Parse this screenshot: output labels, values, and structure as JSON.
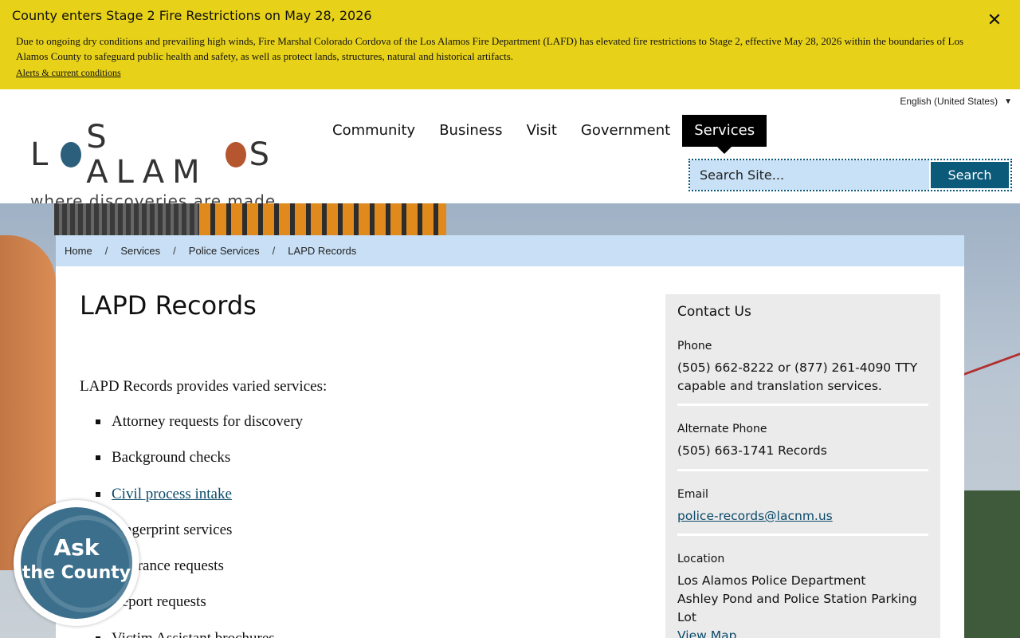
{
  "alert": {
    "title": "County enters Stage 2 Fire Restrictions on May 28, 2026",
    "body": "Due to ongoing dry conditions and prevailing high winds, Fire Marshal Colorado Cordova of the Los Alamos Fire Department (LAFD) has elevated fire restrictions to Stage 2, effective May 28, 2026 within the boundaries of Los Alamos County to safeguard public health and safety, as well as protect lands, structures, natural and historical artifacts.",
    "link": "Alerts & current conditions",
    "close": "✕"
  },
  "header": {
    "language": "English (United States)",
    "logo_top_left": "L",
    "logo_top_mid": "S ALAM",
    "logo_top_right": "S",
    "logo_tagline": "where discoveries are made",
    "nav": [
      "Community",
      "Business",
      "Visit",
      "Government",
      "Services"
    ],
    "search_placeholder": "Search Site...",
    "search_button": "Search"
  },
  "breadcrumb": [
    "Home",
    "Services",
    "Police Services",
    "LAPD Records"
  ],
  "main": {
    "title": "LAPD Records",
    "intro": "LAPD Records provides varied services:",
    "services": [
      "Attorney requests for discovery",
      "Background checks",
      "Civil process intake",
      "Fingerprint services",
      "Insurance requests",
      "Report requests",
      "Victim Assistant brochures"
    ]
  },
  "contact": {
    "title": "Contact Us",
    "phone_label": "Phone",
    "phone_value": "(505) 662-8222 or (877) 261-4090 TTY capable and translation services.",
    "alt_phone_label": "Alternate Phone",
    "alt_phone_value": "(505) 663-1741 Records",
    "email_label": "Email",
    "email_value": "police-records@lacnm.us",
    "location_label": "Location",
    "location_line1": "Los Alamos Police Department",
    "location_line2": "Ashley Pond and Police Station Parking Lot",
    "map_link": "View Map"
  },
  "ask_widget": {
    "line1": "Ask",
    "line2": "the County"
  },
  "colors": {
    "alert_bg": "#e8d219",
    "brand_blue": "#0b5a7a",
    "breadcrumb_bg": "#c8dff5",
    "sidebar_bg": "#ebebeb"
  }
}
